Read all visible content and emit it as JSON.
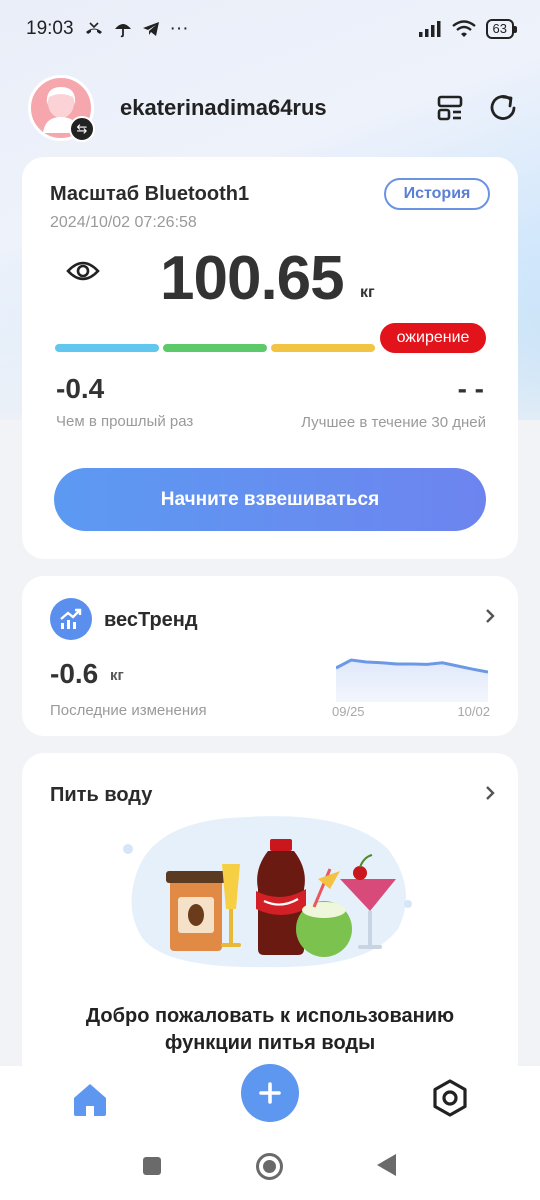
{
  "status_bar": {
    "time": "19:03",
    "notif_icons": [
      "missed-call-icon",
      "umbrella-icon",
      "telegram-icon"
    ],
    "more": "···",
    "battery": "63"
  },
  "header": {
    "username": "ekaterinadima64rus"
  },
  "scale_card": {
    "scale_name": "Масштаб Bluetooth1",
    "history_label": "История",
    "datetime": "2024/10/02 07:26:58",
    "weight": "100.65",
    "unit": "кг",
    "bmi_segment_colors": [
      "#62c7ef",
      "#5cc96b",
      "#f2c443",
      "#e3131b"
    ],
    "status_badge": "ожирение",
    "status_color": "#e3131b",
    "delta_value": "-0.4",
    "delta_label": "Чем в прошлый раз",
    "best_value": "- -",
    "best_label": "Лучшее в течение 30 дней",
    "start_label": "Начните взвешиваться"
  },
  "trend_card": {
    "title": "весТренд",
    "value": "-0.6",
    "unit": "кг",
    "label": "Последние изменения",
    "date_start": "09/25",
    "date_end": "10/02",
    "sparkline": [
      0.35,
      0.15,
      0.2,
      0.22,
      0.25,
      0.25,
      0.26,
      0.22,
      0.3,
      0.38,
      0.45
    ]
  },
  "water_card": {
    "title": "Пить воду",
    "welcome": "Добро пожаловать к использованию функции питья воды"
  },
  "colors": {
    "accent": "#5d97f0",
    "danger": "#e3131b"
  }
}
